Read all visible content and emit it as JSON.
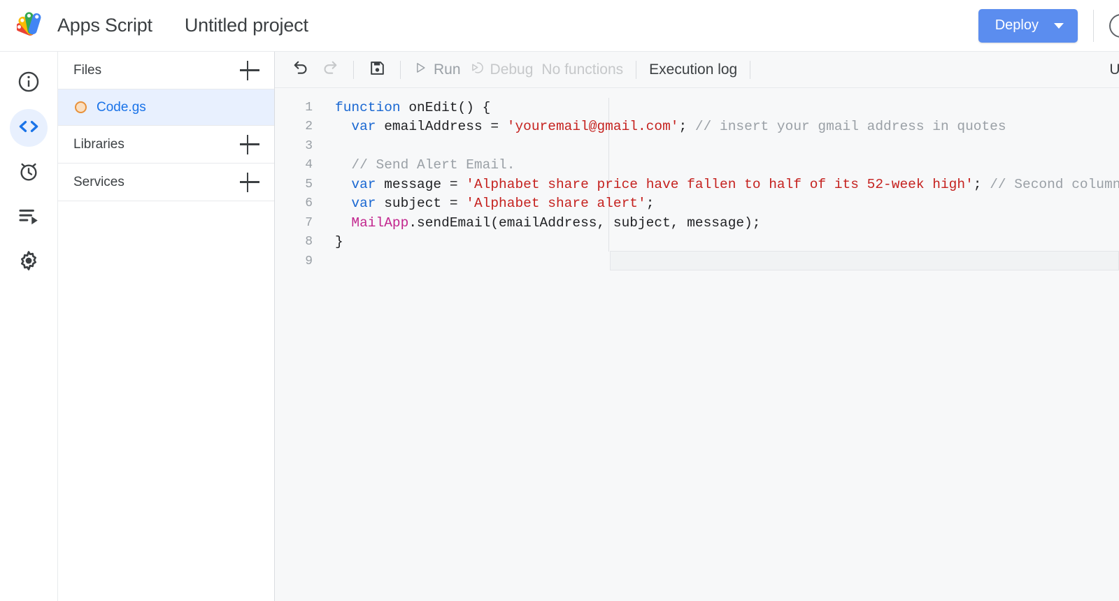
{
  "topbar": {
    "logo_icon": "apps-script-logo",
    "brand": "Apps Script",
    "project_title": "Untitled project",
    "deploy_label": "Deploy",
    "deploy_caret_icon": "chevron-down-icon",
    "deploy_color": "#5b8def",
    "help_icon": "help-circle-icon"
  },
  "rail": {
    "items": [
      {
        "name": "overview",
        "icon": "info-circle-icon",
        "active": false
      },
      {
        "name": "editor",
        "icon": "code-brackets-icon",
        "active": true
      },
      {
        "name": "triggers",
        "icon": "alarm-clock-icon",
        "active": false
      },
      {
        "name": "executions",
        "icon": "executions-list-icon",
        "active": false
      },
      {
        "name": "settings",
        "icon": "gear-icon",
        "active": false
      }
    ],
    "active_color": "#1a73e8",
    "active_bg": "#e8f0fe"
  },
  "files_panel": {
    "sections": [
      {
        "label": "Files",
        "add_icon": "plus-icon"
      },
      {
        "label": "Libraries",
        "add_icon": "plus-icon"
      },
      {
        "label": "Services",
        "add_icon": "plus-icon"
      }
    ],
    "files": [
      {
        "name": "Code.gs",
        "status_icon": "file-status-circle",
        "selected": true
      }
    ]
  },
  "toolbar": {
    "undo_icon": "undo-arrow-icon",
    "redo_icon": "redo-arrow-icon",
    "save_icon": "save-floppy-icon",
    "run_label": "Run",
    "run_icon": "play-triangle-icon",
    "debug_label": "Debug",
    "debug_icon": "debug-step-icon",
    "function_select_label": "No functions",
    "execution_log_label": "Execution log",
    "right_label": "Us"
  },
  "code": {
    "lines": [
      {
        "n": "1",
        "tokens": [
          {
            "t": "function ",
            "c": "kw"
          },
          {
            "t": "onEdit() {",
            "c": "pln"
          }
        ]
      },
      {
        "n": "2",
        "tokens": [
          {
            "t": "  ",
            "c": "pln"
          },
          {
            "t": "var ",
            "c": "kw"
          },
          {
            "t": "emailAddress = ",
            "c": "pln"
          },
          {
            "t": "'youremail@gmail.com'",
            "c": "str"
          },
          {
            "t": "; ",
            "c": "pln"
          },
          {
            "t": "// insert your gmail address in quotes",
            "c": "com"
          }
        ]
      },
      {
        "n": "3",
        "tokens": []
      },
      {
        "n": "4",
        "tokens": [
          {
            "t": "  ",
            "c": "pln"
          },
          {
            "t": "// Send Alert Email.",
            "c": "com"
          }
        ]
      },
      {
        "n": "5",
        "tokens": [
          {
            "t": "  ",
            "c": "pln"
          },
          {
            "t": "var ",
            "c": "kw"
          },
          {
            "t": "message = ",
            "c": "pln"
          },
          {
            "t": "'Alphabet share price have fallen to half of its 52-week high'",
            "c": "str"
          },
          {
            "t": "; ",
            "c": "pln"
          },
          {
            "t": "// Second column",
            "c": "com"
          }
        ]
      },
      {
        "n": "6",
        "tokens": [
          {
            "t": "  ",
            "c": "pln"
          },
          {
            "t": "var ",
            "c": "kw"
          },
          {
            "t": "subject = ",
            "c": "pln"
          },
          {
            "t": "'Alphabet share alert'",
            "c": "str"
          },
          {
            "t": ";",
            "c": "pln"
          }
        ]
      },
      {
        "n": "7",
        "tokens": [
          {
            "t": "  ",
            "c": "pln"
          },
          {
            "t": "MailApp",
            "c": "cls"
          },
          {
            "t": ".sendEmail(emailAddress, subject, message);",
            "c": "pln"
          }
        ]
      },
      {
        "n": "8",
        "tokens": [
          {
            "t": "}",
            "c": "pln"
          }
        ]
      },
      {
        "n": "9",
        "tokens": []
      }
    ]
  }
}
